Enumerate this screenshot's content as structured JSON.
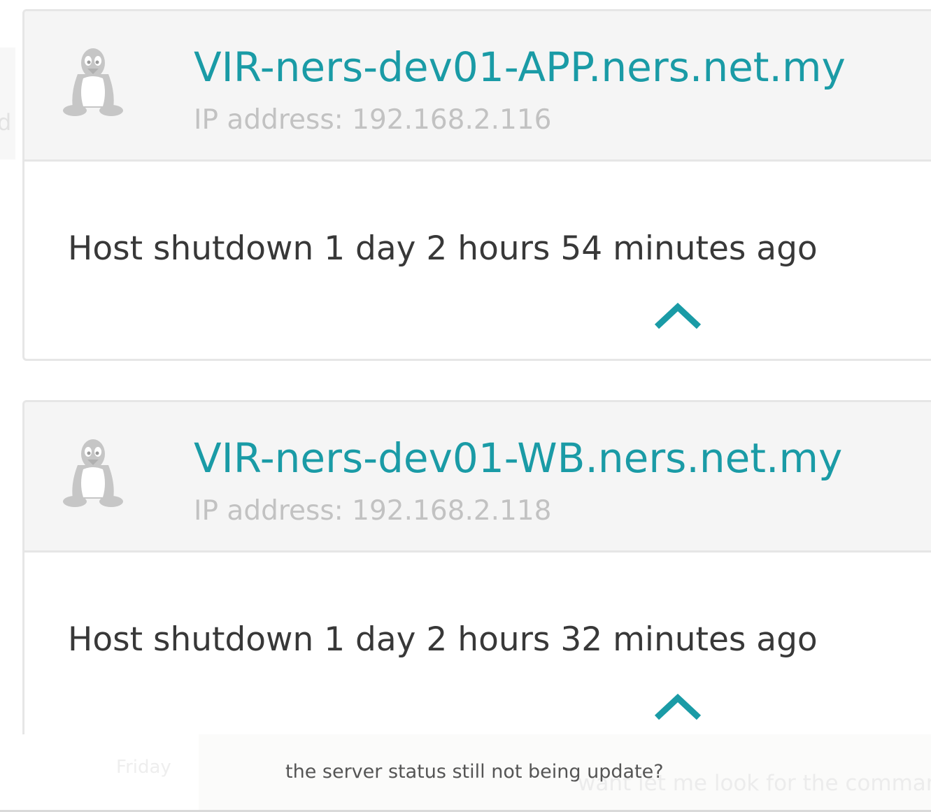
{
  "hosts": [
    {
      "name": "VIR-ners-dev01-APP.ners.net.my",
      "ip_label": "IP address: 192.168.2.116",
      "status": "Host shutdown 1 day 2 hours 54 minutes ago",
      "os_icon": "linux-penguin-icon",
      "toggle_icon": "chevron-up-icon"
    },
    {
      "name": "VIR-ners-dev01-WB.ners.net.my",
      "ip_label": "IP address: 192.168.2.118",
      "status": "Host shutdown 1 day 2 hours 32 minutes ago",
      "os_icon": "linux-penguin-icon",
      "toggle_icon": "chevron-up-icon"
    }
  ],
  "background": {
    "left_fragment": "d",
    "day_label": "Friday",
    "reply_fragment": "want let me look for the command t"
  },
  "chat": {
    "message": "the server status still not being update?"
  },
  "colors": {
    "accent": "#1a9ba6",
    "ip_text": "#c2c2c2",
    "status_text": "#383838",
    "header_bg": "#f5f5f5",
    "card_border": "#e6e6e6",
    "icon_gray": "#c6c6c6"
  }
}
